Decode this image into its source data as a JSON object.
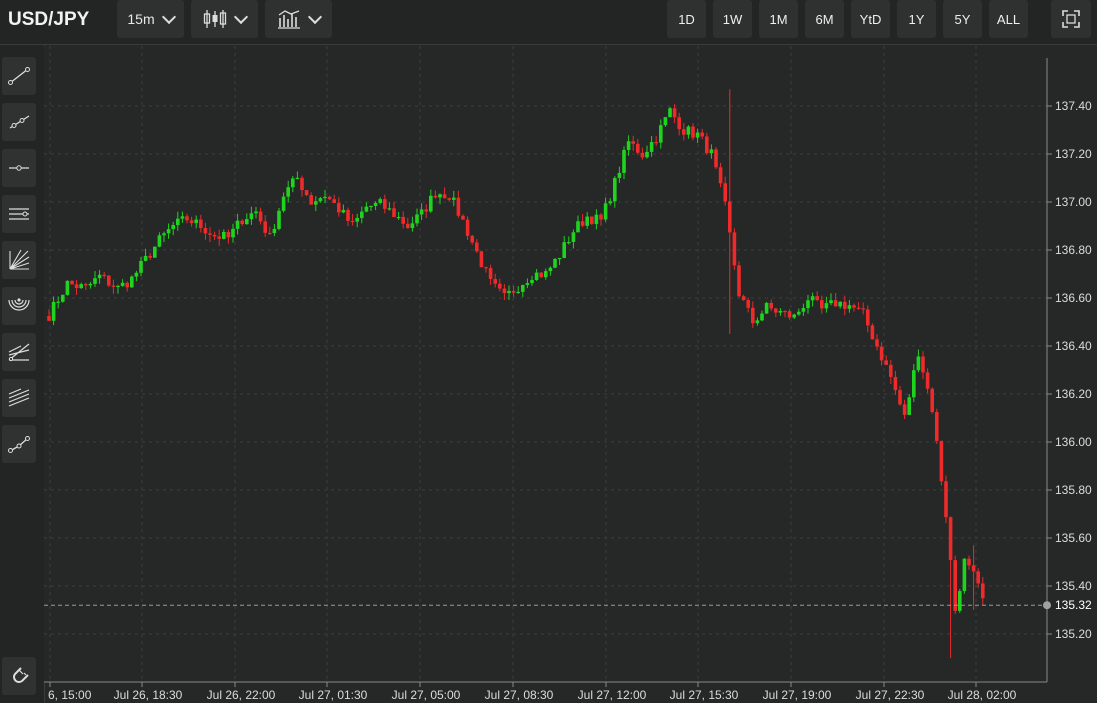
{
  "symbol": "USD/JPY",
  "interval": "15m",
  "chart_type_icon": "candlestick-icon",
  "indicators_icon": "indicators-icon",
  "ranges": [
    "1D",
    "1W",
    "1M",
    "6M",
    "YtD",
    "1Y",
    "5Y",
    "ALL"
  ],
  "fullscreen_icon": "fullscreen-icon",
  "tools": [
    "trend-line-icon",
    "ray-icon",
    "horizontal-line-icon",
    "parallel-channel-icon",
    "fan-icon",
    "arc-icon",
    "pitchfork-icon",
    "fibonacci-icon",
    "path-icon"
  ],
  "magnet_icon": "magnet-icon",
  "colors": {
    "up": "#1ed41e",
    "down": "#ee2a2a",
    "background": "#262727",
    "grid": "#3c3d3d"
  },
  "chart_data": {
    "type": "candlestick",
    "ylim": [
      135.05,
      137.48
    ],
    "yticks": [
      137.4,
      137.2,
      137.0,
      136.8,
      136.6,
      136.4,
      136.2,
      136.0,
      135.8,
      135.6,
      135.4,
      135.2
    ],
    "ytick_labels": [
      "137.40",
      "137.20",
      "137.00",
      "136.80",
      "136.60",
      "136.40",
      "136.20",
      "136.00",
      "135.80",
      "135.60",
      "135.40",
      "135.20"
    ],
    "xtick_labels": [
      "Jul 26, 15:00",
      "Jul 26, 18:30",
      "Jul 26, 22:00",
      "Jul 27, 01:30",
      "Jul 27, 05:00",
      "Jul 27, 08:30",
      "Jul 27, 12:00",
      "Jul 27, 15:30",
      "Jul 27, 19:00",
      "Jul 27, 22:30",
      "Jul 28, 02:00"
    ],
    "first_xtick_visible_text": "6, 15:00",
    "last_price": 135.32,
    "last_price_label": "135.32",
    "grid": true,
    "anchors": [
      [
        0,
        136.53
      ],
      [
        4,
        136.66
      ],
      [
        8,
        136.64
      ],
      [
        11,
        136.69
      ],
      [
        15,
        136.64
      ],
      [
        18,
        136.68
      ],
      [
        21,
        136.76
      ],
      [
        24,
        136.84
      ],
      [
        27,
        136.9
      ],
      [
        30,
        136.93
      ],
      [
        33,
        136.9
      ],
      [
        36,
        136.86
      ],
      [
        39,
        136.85
      ],
      [
        42,
        136.93
      ],
      [
        45,
        136.96
      ],
      [
        48,
        136.85
      ],
      [
        51,
        137.03
      ],
      [
        54,
        137.1
      ],
      [
        57,
        137.0
      ],
      [
        60,
        137.03
      ],
      [
        63,
        136.97
      ],
      [
        66,
        136.9
      ],
      [
        69,
        136.98
      ],
      [
        72,
        136.99
      ],
      [
        75,
        136.95
      ],
      [
        78,
        136.9
      ],
      [
        81,
        136.95
      ],
      [
        84,
        137.04
      ],
      [
        87,
        137.03
      ],
      [
        90,
        136.92
      ],
      [
        93,
        136.79
      ],
      [
        96,
        136.66
      ],
      [
        99,
        136.6
      ],
      [
        102,
        136.65
      ],
      [
        105,
        136.7
      ],
      [
        108,
        136.7
      ],
      [
        111,
        136.78
      ],
      [
        114,
        136.88
      ],
      [
        117,
        136.94
      ],
      [
        120,
        136.92
      ],
      [
        123,
        137.08
      ],
      [
        126,
        137.25
      ],
      [
        129,
        137.2
      ],
      [
        132,
        137.27
      ],
      [
        135,
        137.38
      ],
      [
        138,
        137.3
      ],
      [
        141,
        137.28
      ],
      [
        144,
        137.2
      ],
      [
        147,
        136.98
      ],
      [
        150,
        136.62
      ],
      [
        153,
        136.5
      ],
      [
        156,
        136.56
      ],
      [
        159,
        136.54
      ],
      [
        162,
        136.52
      ],
      [
        165,
        136.6
      ],
      [
        168,
        136.55
      ],
      [
        171,
        136.58
      ],
      [
        174,
        136.57
      ],
      [
        177,
        136.53
      ],
      [
        180,
        136.4
      ],
      [
        183,
        136.27
      ],
      [
        186,
        136.1
      ],
      [
        189,
        136.38
      ],
      [
        192,
        136.14
      ],
      [
        195,
        135.7
      ],
      [
        197,
        135.3
      ],
      [
        199,
        135.5
      ],
      [
        201,
        135.44
      ],
      [
        203,
        135.34
      ]
    ],
    "spikes": [
      [
        148,
        137.47,
        136.45
      ],
      [
        196,
        135.33,
        135.1
      ],
      [
        201,
        135.57,
        135.3
      ]
    ]
  }
}
